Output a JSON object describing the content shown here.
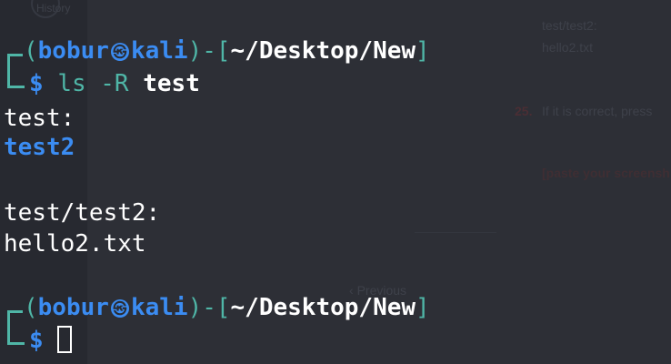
{
  "background": {
    "sidebar_label": "History",
    "snippet_dir": "test/test2:",
    "snippet_file": "hello2.txt",
    "step_number": "25.",
    "step_text": "If it is correct, press",
    "placeholder": "[paste your screensh",
    "prev_link": "Previous"
  },
  "terminal": {
    "prompt1": {
      "open": "(",
      "user": "bobur",
      "skull": "㉿",
      "host": "kali",
      "close": ")-[",
      "path": "~/Desktop/New",
      "end": "]"
    },
    "command1": {
      "symbol": "$",
      "cmd": "ls -R ",
      "arg": "test"
    },
    "output": {
      "line1": "test:",
      "line2": "test2",
      "line3": "test/test2:",
      "line4": "hello2.txt"
    },
    "prompt2": {
      "open": "(",
      "user": "bobur",
      "skull": "㉿",
      "host": "kali",
      "close": ")-[",
      "path": "~/Desktop/New",
      "end": "]"
    },
    "command2": {
      "symbol": "$"
    }
  },
  "colors": {
    "teal": "#4fb6a7",
    "blue": "#3b8cf2",
    "background": "#2a2c33"
  }
}
